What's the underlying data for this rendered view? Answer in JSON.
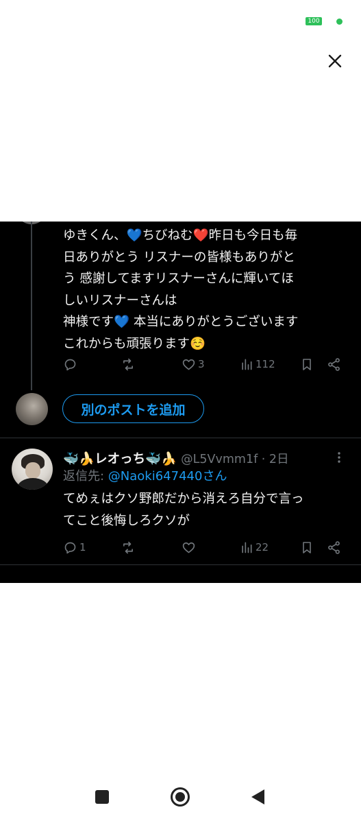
{
  "status_bar": {
    "battery": "100"
  },
  "icons": {
    "close": "close-icon",
    "reply": "reply-icon",
    "repost": "repost-icon",
    "like": "heart-icon",
    "views": "views-icon",
    "bookmark": "bookmark-icon",
    "share": "share-icon",
    "more": "more-vertical-icon",
    "nav_recents": "square-icon",
    "nav_home": "circle-icon",
    "nav_back": "back-triangle-icon"
  },
  "colors": {
    "background": "#000000",
    "text": "#e7e9ea",
    "muted": "#71767b",
    "accent": "#1d9bf0",
    "battery": "#2ec05a"
  },
  "post": {
    "lines": [
      "ゆきくん、💙ちびねむ❤️昨日も今日も毎",
      "日ありがとう リスナーの皆様もありがと",
      "う 感謝してますリスナーさんに輝いてほ",
      "しいリスナーさんは",
      " 神様です💙 本当にありがとうございます",
      "これからも頑張ります☺️"
    ],
    "actions": {
      "replies": "",
      "reposts": "",
      "likes": "3",
      "views": "112"
    }
  },
  "add_post_button": "別のポストを追加",
  "reply": {
    "display_name": "🐳🍌レオっち🐳🍌",
    "handle_time": "@L5Vvmm1f · 2日",
    "reply_to_label": "返信先: ",
    "reply_to_mention": "@Naoki647440さん",
    "lines": [
      "てめぇはクソ野郎だから消えろ自分で言っ",
      "てこと後悔しろクソが"
    ],
    "actions": {
      "replies": "1",
      "reposts": "",
      "likes": "",
      "views": "22"
    }
  }
}
